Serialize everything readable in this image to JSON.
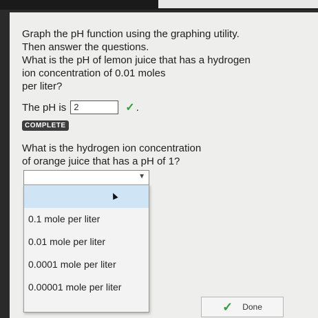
{
  "question1": {
    "lines": [
      "Graph the pH function using the graphing utility.",
      "Then answer the questions.",
      "What is the pH of lemon juice that has a hydrogen",
      "ion concentration of 0.01 moles",
      "per liter?"
    ],
    "answer_prefix": "The pH is",
    "answer_value": "2",
    "answer_suffix": "."
  },
  "status_badge": "COMPLETE",
  "question2": {
    "lines": [
      "What is the hydrogen ion concentration",
      "of orange juice that has a pH of 1?"
    ],
    "selected_value": ""
  },
  "dropdown": {
    "options": [
      "",
      "0.1 mole per liter",
      "0.01 mole per liter",
      "0.0001 mole per liter",
      "0.00001 mole per liter"
    ]
  },
  "done_button": {
    "label": "Done"
  },
  "icons": {
    "correct": "check-icon",
    "select": "chevron-down-icon",
    "cursor": "mouse-pointer-icon"
  },
  "colors": {
    "check_green": "#2e9d3a",
    "selected_option": "#cfe4f5"
  }
}
